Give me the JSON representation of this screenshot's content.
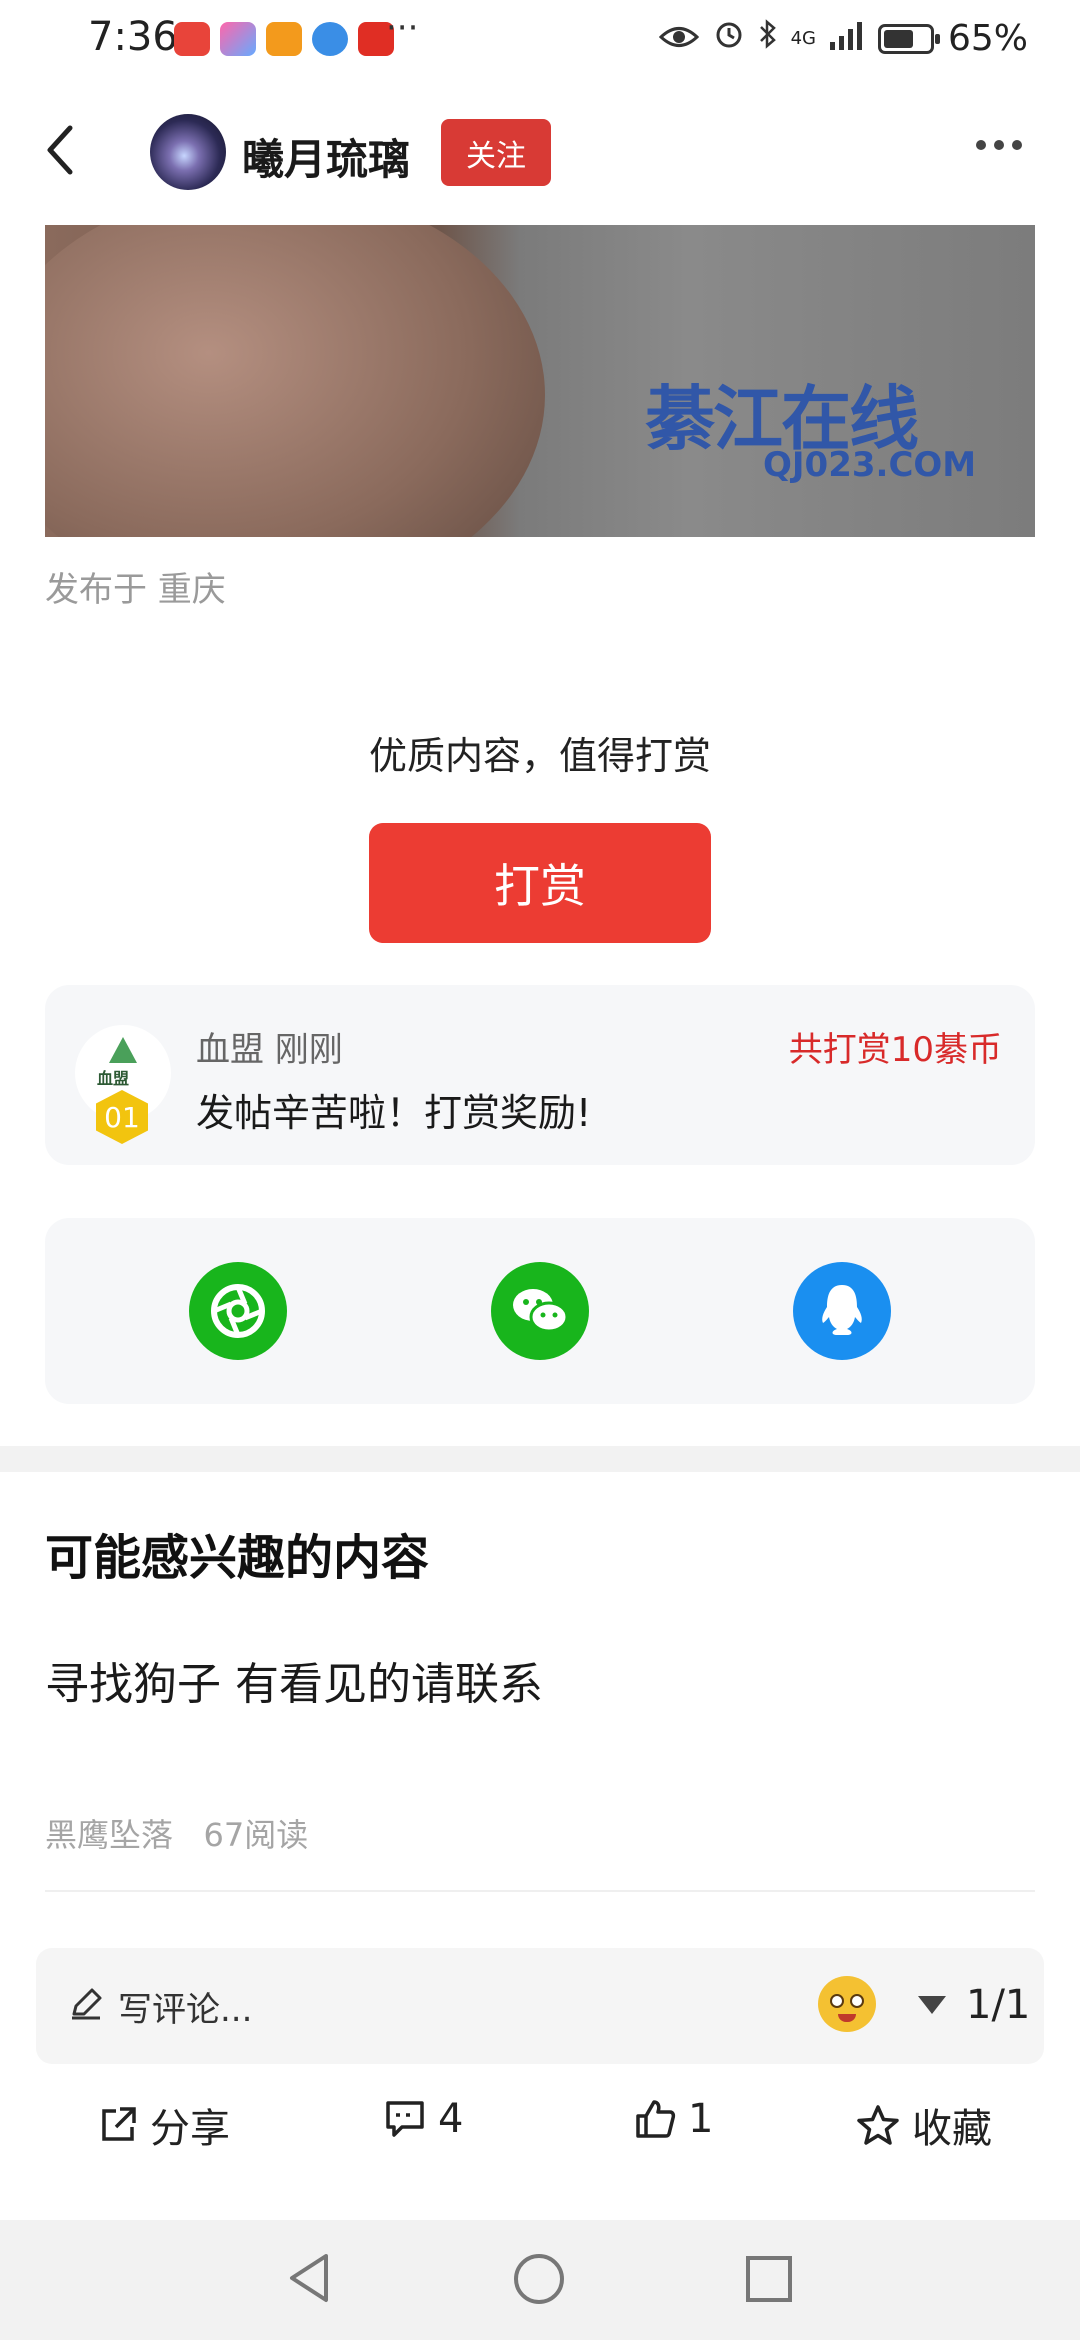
{
  "status_bar": {
    "time": "7:36",
    "dots": "···",
    "network": "4G",
    "battery": "65%",
    "battery_level": 0.65
  },
  "header": {
    "author": "曦月琉璃",
    "follow_label": "关注"
  },
  "post": {
    "watermark_main": "綦江在线",
    "watermark_url": "QJ023.COM",
    "published": "发布于 重庆"
  },
  "tip": {
    "prompt": "优质内容，值得打赏",
    "button_label": "打赏",
    "record": {
      "badge": "01",
      "logo_text": "血盟",
      "user_time": "血盟 刚刚",
      "total": "共打赏10綦币",
      "message": "发帖辛苦啦！打赏奖励!"
    }
  },
  "share": {
    "icons": [
      "moments-icon",
      "wechat-icon",
      "qq-icon"
    ]
  },
  "recommend": {
    "title": "可能感兴趣的内容",
    "item_title": "寻找狗子 有看见的请联系",
    "item_meta": "黑鹰坠落   67阅读"
  },
  "comment": {
    "placeholder": "写评论...",
    "page": "1/1"
  },
  "actions": {
    "share": "分享",
    "comments": "4",
    "likes": "1",
    "favorite": "收藏"
  }
}
